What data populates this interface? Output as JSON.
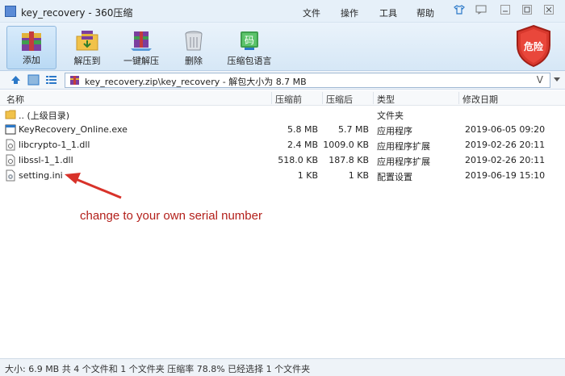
{
  "window": {
    "title": "key_recovery - 360压缩"
  },
  "menu": {
    "file": "文件",
    "ops": "操作",
    "tools": "工具",
    "help": "帮助"
  },
  "toolbar": {
    "add": "添加",
    "extract_to": "解压到",
    "one_click_extract": "一键解压",
    "delete": "删除",
    "archive_language": "压缩包语言"
  },
  "danger": {
    "label": "危险"
  },
  "address": {
    "path": "key_recovery.zip\\key_recovery - 解包大小为 8.7 MB"
  },
  "columns": {
    "name": "名称",
    "before": "压缩前",
    "after": "压缩后",
    "type": "类型",
    "modified": "修改日期"
  },
  "files": [
    {
      "name": ".. (上级目录)",
      "before": "",
      "after": "",
      "type": "文件夹",
      "modified": "",
      "icon": "folder-icon"
    },
    {
      "name": "KeyRecovery_Online.exe",
      "before": "5.8 MB",
      "after": "5.7 MB",
      "type": "应用程序",
      "modified": "2019-06-05 09:20",
      "icon": "exe-icon"
    },
    {
      "name": "libcrypto-1_1.dll",
      "before": "2.4 MB",
      "after": "1009.0 KB",
      "type": "应用程序扩展",
      "modified": "2019-02-26 20:11",
      "icon": "dll-icon"
    },
    {
      "name": "libssl-1_1.dll",
      "before": "518.0 KB",
      "after": "187.8 KB",
      "type": "应用程序扩展",
      "modified": "2019-02-26 20:11",
      "icon": "dll-icon"
    },
    {
      "name": "setting.ini",
      "before": "1 KB",
      "after": "1 KB",
      "type": "配置设置",
      "modified": "2019-06-19 15:10",
      "icon": "ini-icon"
    }
  ],
  "annotation": {
    "text": "change to your own serial number"
  },
  "status": {
    "text": "大小: 6.9 MB 共 4 个文件和 1 个文件夹 压缩率 78.8% 已经选择 1 个文件夹"
  }
}
